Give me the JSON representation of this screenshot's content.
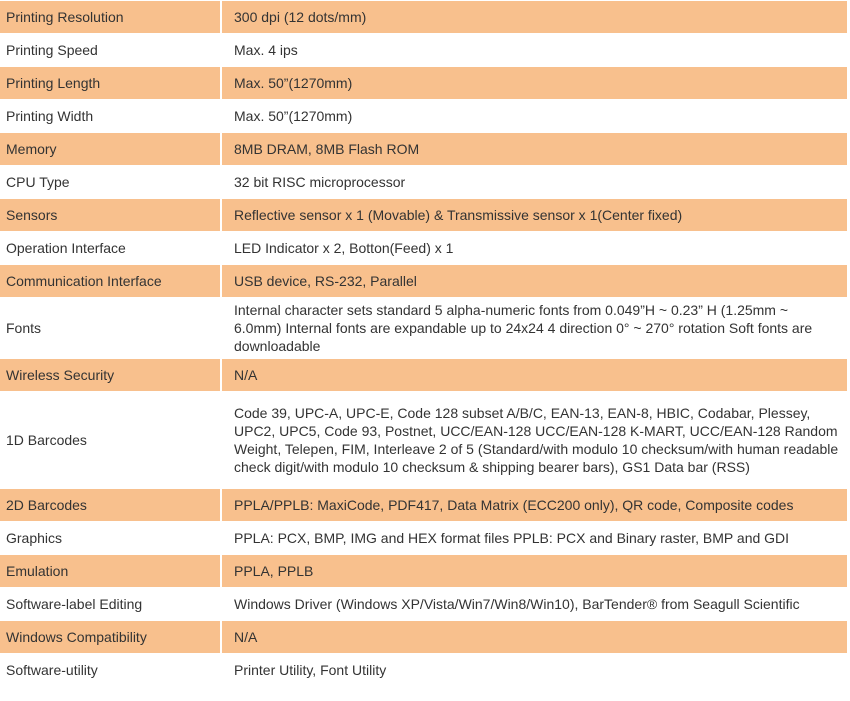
{
  "specs": [
    {
      "label": "Printing Resolution",
      "value": "300 dpi (12 dots/mm)",
      "shaded": true
    },
    {
      "label": "Printing Speed",
      "value": "Max. 4 ips",
      "shaded": false
    },
    {
      "label": "Printing Length",
      "value": "Max. 50”(1270mm)",
      "shaded": true
    },
    {
      "label": "Printing Width",
      "value": "Max. 50”(1270mm)",
      "shaded": false
    },
    {
      "label": "Memory",
      "value": "8MB DRAM, 8MB Flash ROM",
      "shaded": true
    },
    {
      "label": "CPU Type",
      "value": "32 bit RISC microprocessor",
      "shaded": false
    },
    {
      "label": "Sensors",
      "value": "Reflective sensor x 1 (Movable) & Transmissive sensor x 1(Center fixed)",
      "shaded": true
    },
    {
      "label": "Operation Interface",
      "value": "LED Indicator x 2, Botton(Feed) x 1",
      "shaded": false
    },
    {
      "label": "Communication Interface",
      "value": "USB device, RS-232, Parallel",
      "shaded": true
    },
    {
      "label": "Fonts",
      "value": "Internal character sets standard 5 alpha-numeric fonts from 0.049”H ~ 0.23” H (1.25mm ~ 6.0mm) Internal fonts are expandable up to 24x24 4 direction 0° ~ 270° rotation Soft fonts are downloadable",
      "shaded": false,
      "size": "tall3"
    },
    {
      "label": "Wireless Security",
      "value": "N/A",
      "shaded": true
    },
    {
      "label": "1D Barcodes",
      "value": "Code 39, UPC-A, UPC-E, Code 128 subset A/B/C, EAN-13, EAN-8, HBIC, Codabar, Plessey, UPC2, UPC5, Code 93, Postnet, UCC/EAN-128 UCC/EAN-128 K-MART, UCC/EAN-128 Random Weight, Telepen, FIM, Interleave 2 of 5 (Standard/with modulo 10 checksum/with human readable check digit/with modulo 10 checksum & shipping bearer bars), GS1 Data bar (RSS)",
      "shaded": false,
      "size": "tall5"
    },
    {
      "label": "2D Barcodes",
      "value": "PPLA/PPLB: MaxiCode, PDF417, Data Matrix (ECC200 only), QR code, Composite codes",
      "shaded": true
    },
    {
      "label": "Graphics",
      "value": "PPLA: PCX, BMP, IMG and HEX format files PPLB: PCX and Binary raster, BMP and GDI",
      "shaded": false
    },
    {
      "label": "Emulation",
      "value": "PPLA, PPLB",
      "shaded": true
    },
    {
      "label": "Software-label Editing",
      "value": "Windows Driver (Windows XP/Vista/Win7/Win8/Win10), BarTender® from Seagull Scientific",
      "shaded": false
    },
    {
      "label": "Windows Compatibility",
      "value": "N/A",
      "shaded": true
    },
    {
      "label": "Software-utility",
      "value": "Printer Utility, Font Utility",
      "shaded": false
    }
  ]
}
